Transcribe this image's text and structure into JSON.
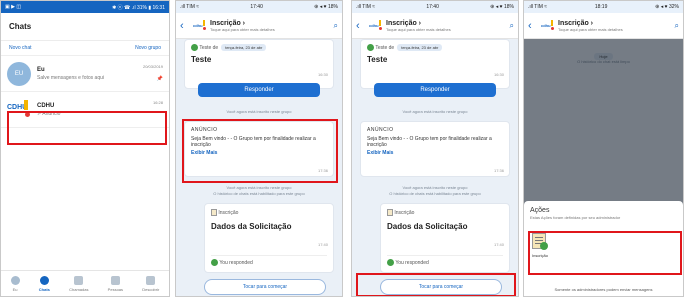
{
  "p1": {
    "status_right": "✱ ⓝ ☎ .ıl 31% ▮ 16:31",
    "title": "Chats",
    "new_chat": "Novo chat",
    "new_group": "Novo grupo",
    "chats": [
      {
        "avatar": "EU",
        "name": "Eu",
        "sub": "Salve mensagens e fotos aqui",
        "date": "20/03/2019"
      },
      {
        "logo": "CDHU",
        "name": "CDHU",
        "sub": "⇗ Anúncio",
        "date": "16:28"
      }
    ],
    "nav": [
      "Eu",
      "Chats",
      "Chamadas",
      "Pessoas",
      "Descobrir"
    ]
  },
  "p2": {
    "status_left": ".ıll TIM ≈",
    "status_time": "17:40",
    "status_right": "⊕ ◂ ♥ 18%",
    "title": "Inscrição ›",
    "subtitle": "Toque aqui para obter mais detalhes",
    "teste_de": "Teste de",
    "date_pill": "terça-feira, 23 de abr",
    "teste": "Teste",
    "ts1": "16:30",
    "responder": "Responder",
    "sys1": "Você agora está inscrito neste grupo",
    "anuncio": "ANÚNCIO",
    "anuncio_body": "Seja Bem vindo - - O Grupo tem por finalidade realizar a inscrição",
    "exibir": "Exibir Mais",
    "ts2": "17:36",
    "sys2a": "Você agora está inscrito neste grupo",
    "sys2b": "O histórico de chats está habilitado para este grupo",
    "inscricao": "Inscrição",
    "dados": "Dados da Solicitação",
    "ts3": "17:40",
    "you_responded": "You responded",
    "tocar": "Tocar para começar"
  },
  "p3": {
    "status_left": ".ıll TIM ≈",
    "status_time": "17:40",
    "status_right": "⊕ ◂ ♥ 18%",
    "title": "Inscrição ›",
    "subtitle": "Toque aqui para obter mais detalhes",
    "teste_de": "Teste de",
    "date_pill": "terça-feira, 23 de abr",
    "teste": "Teste",
    "ts1": "16:30",
    "responder": "Responder",
    "sys1": "Você agora está inscrito neste grupo",
    "anuncio": "ANÚNCIO",
    "anuncio_body": "Seja Bem vindo - - O Grupo tem por finalidade realizar a inscrição",
    "exibir": "Exibir Mais",
    "ts2": "17:36",
    "sys2a": "Você agora está inscrito neste grupo",
    "sys2b": "O histórico de chats está habilitado para este grupo",
    "inscricao": "Inscrição",
    "dados": "Dados da Solicitação",
    "ts3": "17:40",
    "you_responded": "You responded",
    "tocar": "Tocar para começar"
  },
  "p4": {
    "status_left": ".ıll TIM ≈",
    "status_time": "18:19",
    "status_right": "⊕ ◂ ♥ 32%",
    "title": "Inscrição ›",
    "subtitle": "Toque aqui para obter mais detalhes",
    "hoje": "Hoje",
    "limpo": "O histórico do chat está limpo",
    "acoes": "Ações",
    "acoes_sub": "Estas Ações foram definidas por seu administrador",
    "app_label": "Inscrição",
    "footer": "Somente os administradores podem enviar mensagens"
  }
}
